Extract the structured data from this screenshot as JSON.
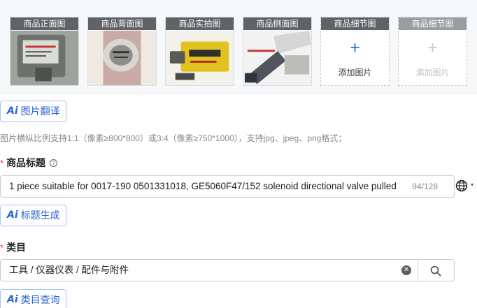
{
  "images": {
    "slots": [
      {
        "label": "商品正面图",
        "state": "filled"
      },
      {
        "label": "商品背面图",
        "state": "filled"
      },
      {
        "label": "商品实拍图",
        "state": "filled"
      },
      {
        "label": "商品侧面图",
        "state": "filled"
      },
      {
        "label": "商品细节图",
        "state": "add",
        "action": "添加图片"
      },
      {
        "label": "商品细节图",
        "state": "add-disabled",
        "action": "添加图片"
      }
    ],
    "translate_button": "图片翻译",
    "hint": "图片横纵比例支持1:1（像素≥800*800）或3:4（像素≥750*1000），支持jpg、jpeg、png格式；"
  },
  "ai_icon": "Ai",
  "title_field": {
    "required_mark": "*",
    "label": "商品标题",
    "help_icon": "?",
    "value": "1 piece suitable for 0017-190 0501331018, GE5060F47/152 solenoid directional valve pulled",
    "counter": "94/128",
    "generate_button": "标题生成",
    "language_icon": "globe-icon"
  },
  "category_field": {
    "required_mark": "*",
    "label": "类目",
    "value": "工具 / 仪器仪表 / 配件与附件",
    "clear_icon": "✕",
    "query_button": "类目查询"
  },
  "colors": {
    "accent": "#2b64d8",
    "required": "#e2382b",
    "caption_bg": "#5f6368"
  }
}
